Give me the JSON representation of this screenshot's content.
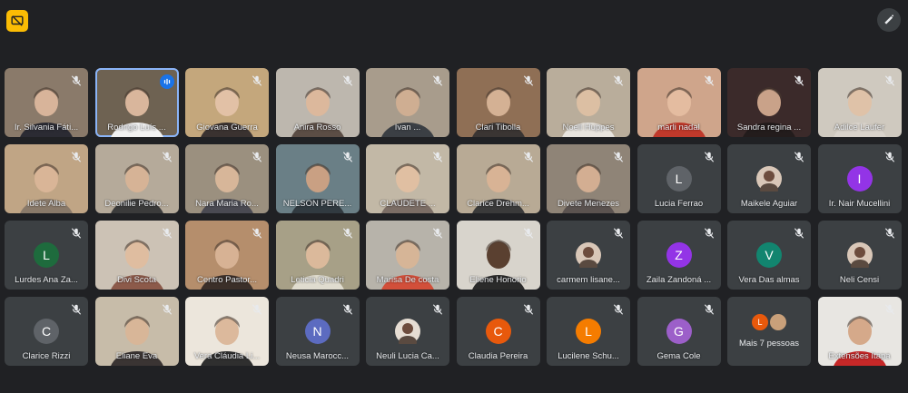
{
  "participants": [
    {
      "name": "Ir. Silvania Fáti...",
      "kind": "video",
      "bg": "#8a7a6a",
      "skin": "#d8b49a",
      "shirt": "#2b2b33"
    },
    {
      "name": "Rodrigo Luís ...",
      "kind": "video",
      "bg": "#6e6252",
      "skin": "#d9b69c",
      "shirt": "#f2f2f2",
      "speaking": true
    },
    {
      "name": "Giovana Guerra",
      "kind": "video",
      "bg": "#c4a77c",
      "skin": "#e2c1a6",
      "shirt": "#3a3230"
    },
    {
      "name": "Anira Rosso",
      "kind": "video",
      "bg": "#bdb7ae",
      "skin": "#dcb89c",
      "shirt": "#5b4d45"
    },
    {
      "name": "Ivan ...",
      "kind": "video",
      "bg": "#a89c8c",
      "skin": "#cfae92",
      "shirt": "#3b3f44"
    },
    {
      "name": "Clari Tibolla",
      "kind": "video",
      "bg": "#8f6f55",
      "skin": "#d4b194",
      "shirt": "#3a3533"
    },
    {
      "name": "Noeli Huppes",
      "kind": "video",
      "bg": "#b9ad9b",
      "skin": "#dcbfa3",
      "shirt": "#e8e4de"
    },
    {
      "name": "marli nadal",
      "kind": "video",
      "bg": "#cfa58b",
      "skin": "#e4bca0",
      "shirt": "#c0392b"
    },
    {
      "name": "Sandra regina ...",
      "kind": "video",
      "bg": "#3b2a2a",
      "skin": "#c9a289",
      "shirt": "#231c1c"
    },
    {
      "name": "Adilce Laufer",
      "kind": "video",
      "bg": "#cfc9bf",
      "skin": "#dfc2a8",
      "shirt": "#d9d3cb"
    },
    {
      "name": "Idete Alba",
      "kind": "video",
      "bg": "#c0a585",
      "skin": "#d9b597",
      "shirt": "#8a7a6a"
    },
    {
      "name": "Deonilie Pedro...",
      "kind": "video",
      "bg": "#b5aa9a",
      "skin": "#d6b396",
      "shirt": "#3b3b3b"
    },
    {
      "name": "Nara Maria Ro...",
      "kind": "video",
      "bg": "#9b907f",
      "skin": "#d7b699",
      "shirt": "#4a4a52"
    },
    {
      "name": "NELSON PERE...",
      "kind": "video",
      "bg": "#6a7f86",
      "skin": "#c9a083",
      "shirt": "#313a40"
    },
    {
      "name": "CLAUDETE ...",
      "kind": "video",
      "bg": "#c2b8a6",
      "skin": "#e0bfa2",
      "shirt": "#7c6e66"
    },
    {
      "name": "Clarice Drehm...",
      "kind": "video",
      "bg": "#b8aa95",
      "skin": "#d8b395",
      "shirt": "#3a3a3a"
    },
    {
      "name": "Divete Menezes",
      "kind": "video",
      "bg": "#8f8477",
      "skin": "#d3ae92",
      "shirt": "#5b5350"
    },
    {
      "name": "Lucia Ferrao",
      "kind": "avatar",
      "letter": "L",
      "color": "#5f6368"
    },
    {
      "name": "Maikele Aguiar",
      "kind": "photo",
      "color": "#d9c7b8"
    },
    {
      "name": "Ir. Nair Mucellini",
      "kind": "avatar",
      "letter": "I",
      "color": "#9334e6"
    },
    {
      "name": "Lurdes Ana Za...",
      "kind": "avatar",
      "letter": "L",
      "color": "#1e6b3d"
    },
    {
      "name": "Divi Scota",
      "kind": "video",
      "bg": "#ccc2b5",
      "skin": "#dfbda0",
      "shirt": "#8c5a4a"
    },
    {
      "name": "Centro Pastor...",
      "kind": "video",
      "bg": "#b58e6c",
      "skin": "#d7b294",
      "shirt": "#3b2f29"
    },
    {
      "name": "Leticia Quadri",
      "kind": "video",
      "bg": "#a7a087",
      "skin": "#dbb99b",
      "shirt": "#e0dccf"
    },
    {
      "name": "Marisa De costa",
      "kind": "video",
      "bg": "#b7b3aa",
      "skin": "#d6b597",
      "shirt": "#d24f3a"
    },
    {
      "name": "Eliene Honorio",
      "kind": "video",
      "bg": "#d8d4cc",
      "skin": "#5a4030",
      "shirt": "#2a2a2a"
    },
    {
      "name": "carmem lisane...",
      "kind": "photo",
      "color": "#d9c7b8"
    },
    {
      "name": "Zaila Zandoná ...",
      "kind": "avatar",
      "letter": "Z",
      "color": "#9334e6"
    },
    {
      "name": "Vera Das almas",
      "kind": "avatar",
      "letter": "V",
      "color": "#12856f"
    },
    {
      "name": "Neli Censi",
      "kind": "photo",
      "color": "#d9c7b8"
    },
    {
      "name": "Clarice Rizzi",
      "kind": "avatar",
      "letter": "C",
      "color": "#5f6368"
    },
    {
      "name": "Eliane Eva",
      "kind": "video",
      "bg": "#c7bca9",
      "skin": "#d8b698",
      "shirt": "#3a3433"
    },
    {
      "name": "Vera Cláudia Li...",
      "kind": "video",
      "bg": "#ece6dc",
      "skin": "#dcb99c",
      "shirt": "#2f2f2f"
    },
    {
      "name": "Neusa Marocc...",
      "kind": "avatar",
      "letter": "N",
      "color": "#5c6bc0"
    },
    {
      "name": "Neuli Lucia Ca...",
      "kind": "photo",
      "color": "#e6ddd3"
    },
    {
      "name": "Claudia Pereira",
      "kind": "avatar",
      "letter": "C",
      "color": "#e8590c"
    },
    {
      "name": "Lucilene Schu...",
      "kind": "avatar",
      "letter": "L",
      "color": "#f57c00"
    },
    {
      "name": "Gema Cole",
      "kind": "avatar",
      "letter": "G",
      "color": "#9c5fc9"
    },
    {
      "name": "Mais 7 pessoas",
      "kind": "more",
      "avatars": [
        {
          "letter": "L",
          "color": "#e8590c"
        },
        {
          "letter": "",
          "color": "#c9a07a"
        }
      ]
    },
    {
      "name": "Extensões Itapa",
      "kind": "video",
      "bg": "#e8e6e2",
      "skin": "#d5a98a",
      "shirt": "#c62828"
    }
  ]
}
